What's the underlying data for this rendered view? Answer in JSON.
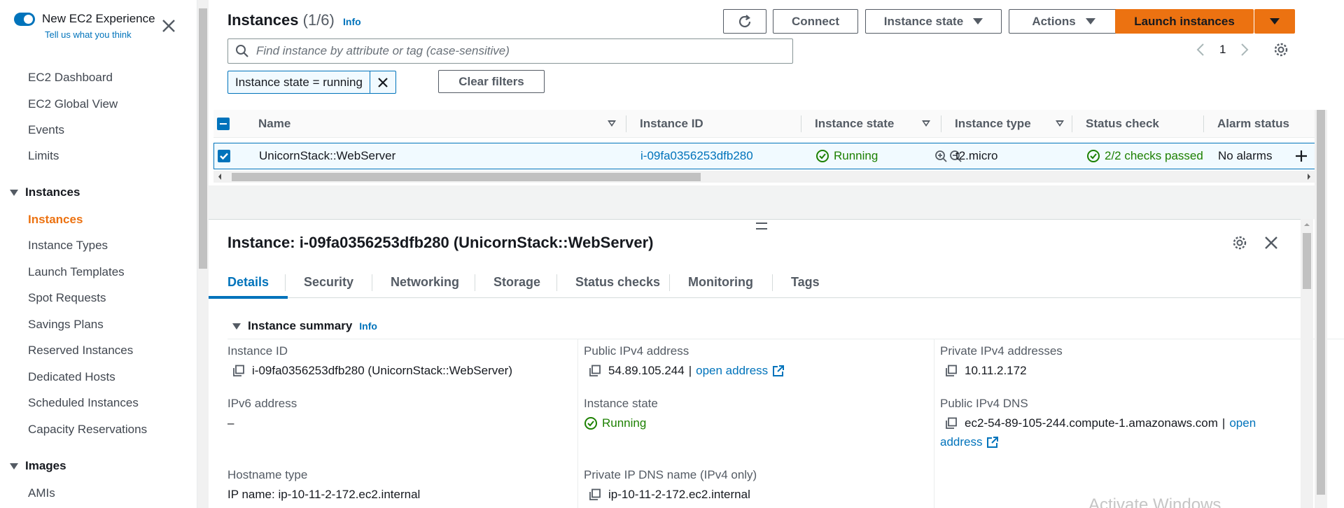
{
  "sidebar": {
    "experience_title": "New EC2 Experience",
    "experience_subtitle": "Tell us what you think",
    "items": [
      {
        "label": "EC2 Dashboard"
      },
      {
        "label": "EC2 Global View"
      },
      {
        "label": "Events"
      },
      {
        "label": "Limits"
      }
    ],
    "section_instances": "Instances",
    "instances_items": [
      {
        "label": "Instances"
      },
      {
        "label": "Instance Types"
      },
      {
        "label": "Launch Templates"
      },
      {
        "label": "Spot Requests"
      },
      {
        "label": "Savings Plans"
      },
      {
        "label": "Reserved Instances"
      },
      {
        "label": "Dedicated Hosts"
      },
      {
        "label": "Scheduled Instances"
      },
      {
        "label": "Capacity Reservations"
      }
    ],
    "section_images": "Images",
    "images_items": [
      {
        "label": "AMIs"
      }
    ]
  },
  "header": {
    "title": "Instances",
    "count": "(1/6)",
    "info": "Info",
    "connect": "Connect",
    "instance_state": "Instance state",
    "actions": "Actions",
    "launch": "Launch instances"
  },
  "search": {
    "placeholder": "Find instance by attribute or tag (case-sensitive)"
  },
  "pager": {
    "page": "1"
  },
  "filters": {
    "token": "Instance state = running",
    "clear": "Clear filters"
  },
  "table": {
    "columns": [
      "Name",
      "Instance ID",
      "Instance state",
      "Instance type",
      "Status check",
      "Alarm status"
    ],
    "rows": [
      {
        "name": "UnicornStack::WebServer",
        "instance_id": "i-09fa0356253dfb280",
        "state": "Running",
        "type": "t2.micro",
        "status_check": "2/2 checks passed",
        "alarm": "No alarms"
      }
    ]
  },
  "detail": {
    "title": "Instance: i-09fa0356253dfb280 (UnicornStack::WebServer)",
    "tabs": [
      "Details",
      "Security",
      "Networking",
      "Storage",
      "Status checks",
      "Monitoring",
      "Tags"
    ],
    "summary_title": "Instance summary",
    "info": "Info",
    "fields": {
      "instance_id_label": "Instance ID",
      "instance_id_value": "i-09fa0356253dfb280 (UnicornStack::WebServer)",
      "ipv6_label": "IPv6 address",
      "ipv6_value": "–",
      "hostname_label": "Hostname type",
      "hostname_value": "IP name: ip-10-11-2-172.ec2.internal",
      "public_ipv4_label": "Public IPv4 address",
      "public_ipv4_value": "54.89.105.244",
      "open_address": "open address",
      "state_label": "Instance state",
      "state_value": "Running",
      "private_dns_label": "Private IP DNS name (IPv4 only)",
      "private_dns_value": "ip-10-11-2-172.ec2.internal",
      "private_ipv4_label": "Private IPv4 addresses",
      "private_ipv4_value": "10.11.2.172",
      "public_dns_label": "Public IPv4 DNS",
      "public_dns_value": "ec2-54-89-105-244.compute-1.amazonaws.com",
      "public_dns_open_1": "open",
      "public_dns_open_2": "address"
    }
  },
  "watermark": "Activate Windows",
  "colors": {
    "accent": "#0073bb",
    "primary_button": "#ec7211",
    "success": "#1d8102",
    "active_nav": "#ec7211"
  }
}
